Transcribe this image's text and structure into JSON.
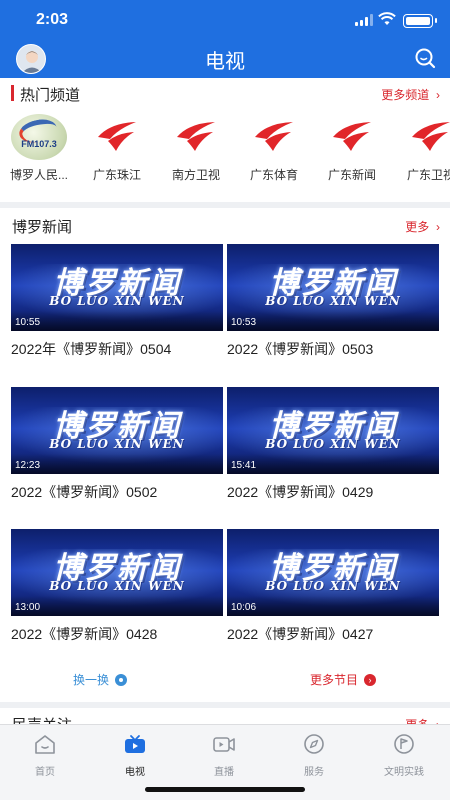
{
  "status_bar": {
    "time": "2:03"
  },
  "header": {
    "title": "电视"
  },
  "hot_channels": {
    "title": "热门频道",
    "more_label": "更多频道",
    "items": [
      {
        "name": "博罗人民...",
        "logo_text": "FM107.3"
      },
      {
        "name": "广东珠江"
      },
      {
        "name": "南方卫视"
      },
      {
        "name": "广东体育"
      },
      {
        "name": "广东新闻"
      },
      {
        "name": "广东卫视"
      }
    ]
  },
  "boluo_news": {
    "title": "博罗新闻",
    "more_label": "更多",
    "thumb_title": "博罗新闻",
    "thumb_subtitle": "BO LUO XIN WEN",
    "items": [
      {
        "duration": "10:55",
        "caption": "2022年《博罗新闻》0504"
      },
      {
        "duration": "10:53",
        "caption": "2022《博罗新闻》0503"
      },
      {
        "duration": "12:23",
        "caption": "2022《博罗新闻》0502"
      },
      {
        "duration": "15:41",
        "caption": "2022《博罗新闻》0429"
      },
      {
        "duration": "13:00",
        "caption": "2022《博罗新闻》0428"
      },
      {
        "duration": "10:06",
        "caption": "2022《博罗新闻》0427"
      }
    ],
    "refresh_label": "换一换",
    "more_programs_label": "更多节目"
  },
  "people_concern": {
    "title": "民声关注",
    "more_label": "更多"
  },
  "tab_bar": {
    "items": [
      {
        "label": "首页",
        "icon": "home-icon"
      },
      {
        "label": "电视",
        "icon": "tv-icon",
        "active": true
      },
      {
        "label": "直播",
        "icon": "video-camera-icon"
      },
      {
        "label": "服务",
        "icon": "compass-icon"
      },
      {
        "label": "文明实践",
        "icon": "flag-badge-icon"
      }
    ]
  },
  "colors": {
    "brand_blue": "#1f6fe0",
    "accent_red": "#d9272e",
    "link_blue": "#3a8fd6"
  }
}
